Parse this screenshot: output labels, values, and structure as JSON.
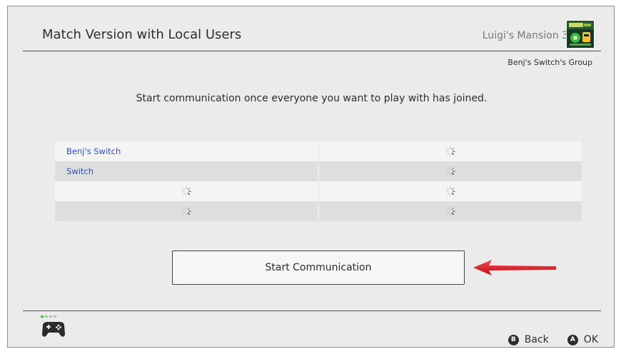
{
  "header": {
    "title": "Match Version with Local Users",
    "game_name": "Luigi's Mansion 3",
    "game_icon": "luigis-mansion-3-icon"
  },
  "group_name": "Benj's Switch's Group",
  "instruction": "Start communication once everyone you want to play with has joined.",
  "user_slots": [
    {
      "name": "Benj's Switch",
      "state": "joined"
    },
    {
      "name": "",
      "state": "waiting"
    },
    {
      "name": "Switch",
      "state": "joined"
    },
    {
      "name": "",
      "state": "waiting"
    },
    {
      "name": "",
      "state": "waiting"
    },
    {
      "name": "",
      "state": "waiting"
    },
    {
      "name": "",
      "state": "waiting"
    },
    {
      "name": "",
      "state": "waiting"
    }
  ],
  "start_button": {
    "label": "Start Communication"
  },
  "annotation": {
    "arrow_color": "#d9141b",
    "points_to": "start-communication-button"
  },
  "footer": {
    "controller_icon": "controller-icon",
    "player_lights": [
      true,
      false,
      false,
      false
    ],
    "back": {
      "glyph": "B",
      "label": "Back"
    },
    "ok": {
      "glyph": "A",
      "label": "OK"
    }
  },
  "colors": {
    "background": "#ebebeb",
    "user_name": "#2f4ec2",
    "player_light_on": "#3ec43e",
    "player_light_off": "#bdbdbd",
    "annotation_arrow": "#d9141b"
  }
}
